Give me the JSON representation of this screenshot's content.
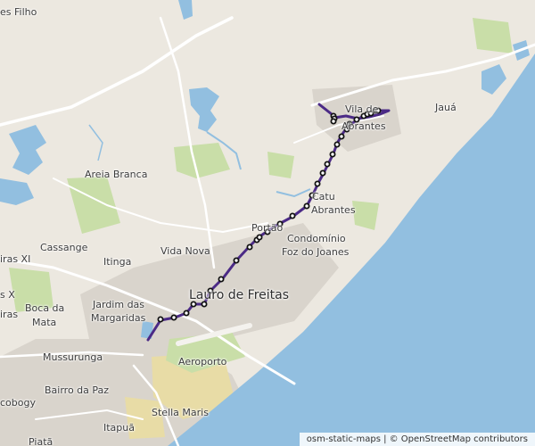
{
  "map": {
    "colors": {
      "land": "#ece8e0",
      "water": "#92bfe0",
      "park": "#c9dea8",
      "urban": "#d9d4cc",
      "industrial": "#e8dca6",
      "road": "#ffffff",
      "route": "#4b2a86",
      "stop_fill": "#ffffff",
      "stop_stroke": "#111111"
    },
    "places": [
      {
        "id": "filho",
        "name": "es Filho"
      },
      {
        "id": "jaua",
        "name": "Jauá"
      },
      {
        "id": "vila-de",
        "name": "Vila de"
      },
      {
        "id": "abrantes",
        "name": "Abrantes"
      },
      {
        "id": "areia-branca",
        "name": "Areia Branca"
      },
      {
        "id": "catu-1",
        "name": "Catu"
      },
      {
        "id": "catu-2",
        "name": "Abrantes"
      },
      {
        "id": "portao",
        "name": "Portão"
      },
      {
        "id": "condominio-1",
        "name": "Condomínio"
      },
      {
        "id": "condominio-2",
        "name": "Foz do Joanes"
      },
      {
        "id": "cassange",
        "name": "Cassange"
      },
      {
        "id": "itinga",
        "name": "Itinga"
      },
      {
        "id": "vida-nova",
        "name": "Vida Nova"
      },
      {
        "id": "iras-xi",
        "name": "iras XI"
      },
      {
        "id": "lauro",
        "name": "Lauro de Freitas"
      },
      {
        "id": "s-x",
        "name": "s X"
      },
      {
        "id": "iras",
        "name": "iras"
      },
      {
        "id": "boca-1",
        "name": "Boca da"
      },
      {
        "id": "boca-2",
        "name": "Mata"
      },
      {
        "id": "jardim-1",
        "name": "Jardim das"
      },
      {
        "id": "jardim-2",
        "name": "Margaridas"
      },
      {
        "id": "mussurunga",
        "name": "Mussurunga"
      },
      {
        "id": "aeroporto",
        "name": "Aeroporto"
      },
      {
        "id": "bairro-paz",
        "name": "Bairro da Paz"
      },
      {
        "id": "cobogy",
        "name": "cobogy"
      },
      {
        "id": "stella",
        "name": "Stella Maris"
      },
      {
        "id": "itapua",
        "name": "Itapuã"
      },
      {
        "id": "piata",
        "name": "Piatã"
      }
    ],
    "route": {
      "stop_count": 33
    },
    "attribution": "osm-static-maps | © OpenStreetMap contributors"
  }
}
